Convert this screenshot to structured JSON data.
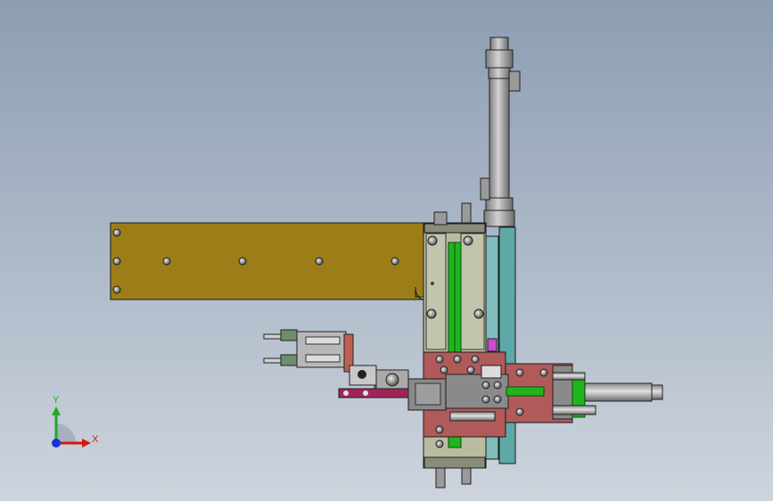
{
  "view": {
    "background_top": "#8d9db2",
    "background_bottom": "#cdd4dd"
  },
  "triad": {
    "y_label": "Y",
    "x_label": "X",
    "y_color": "#22aa22",
    "x_color": "#d01818",
    "z_color": "#1b2fd6"
  },
  "parts": {
    "mounting_plate_color": "#9c7d18",
    "frame_plate_color": "#b9bca0",
    "rail_color": "#1fb51f",
    "cover_plate_color": "#5fa8a8",
    "base_block_color": "#b05a5a",
    "slider_color": "#8a8a8a",
    "cylinder_color": "#a8a8a8",
    "accent_color": "#d04bd0",
    "bracket_color": "#a0245a"
  }
}
